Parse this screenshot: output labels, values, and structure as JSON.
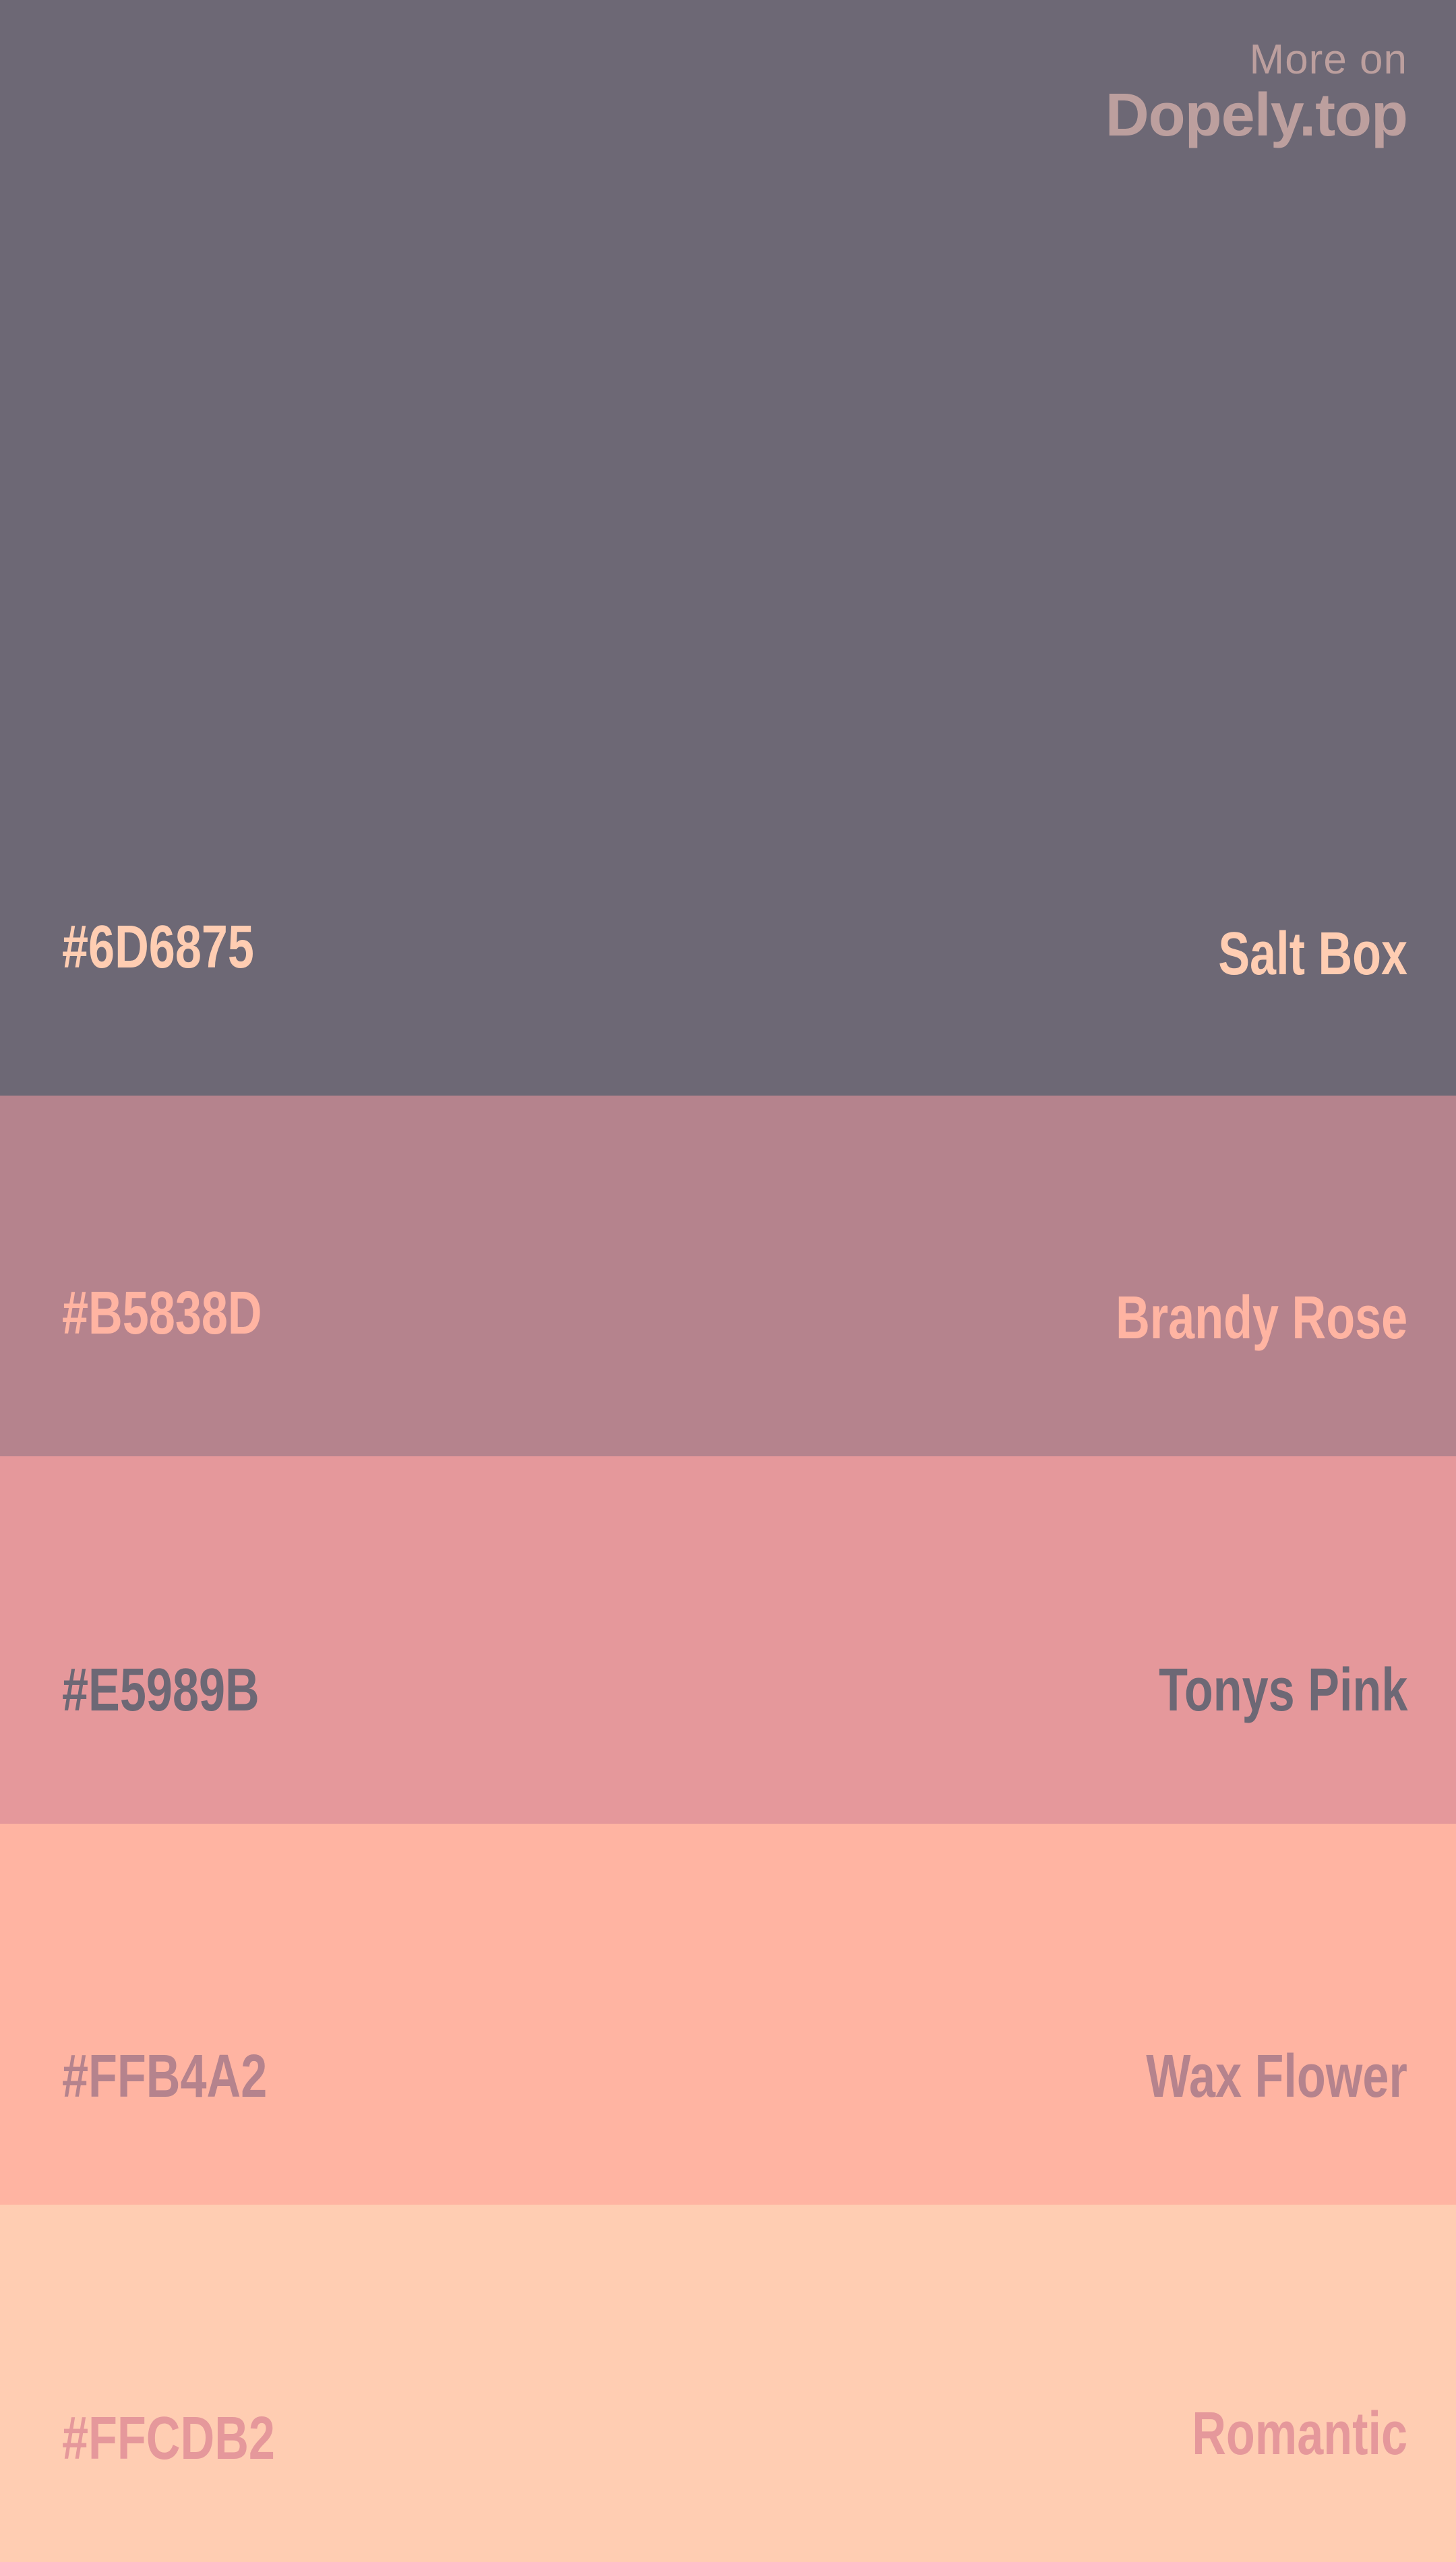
{
  "branding": {
    "line1": "More on",
    "line2": "Dopely.top",
    "color": "#BC9F9E"
  },
  "swatches": [
    {
      "hex": "#6D6875",
      "name": "Salt Box",
      "bg": "#6D6875",
      "text_color": "#FFCDB2"
    },
    {
      "hex": "#B5838D",
      "name": "Brandy Rose",
      "bg": "#B5838D",
      "text_color": "#FFB4A2"
    },
    {
      "hex": "#E5989B",
      "name": "Tonys Pink",
      "bg": "#E5989B",
      "text_color": "#6D6875"
    },
    {
      "hex": "#FFB4A2",
      "name": "Wax Flower",
      "bg": "#FFB4A2",
      "text_color": "#B5838D"
    },
    {
      "hex": "#FFCDB2",
      "name": "Romantic",
      "bg": "#FFCDB2",
      "text_color": "#E5989B"
    }
  ]
}
